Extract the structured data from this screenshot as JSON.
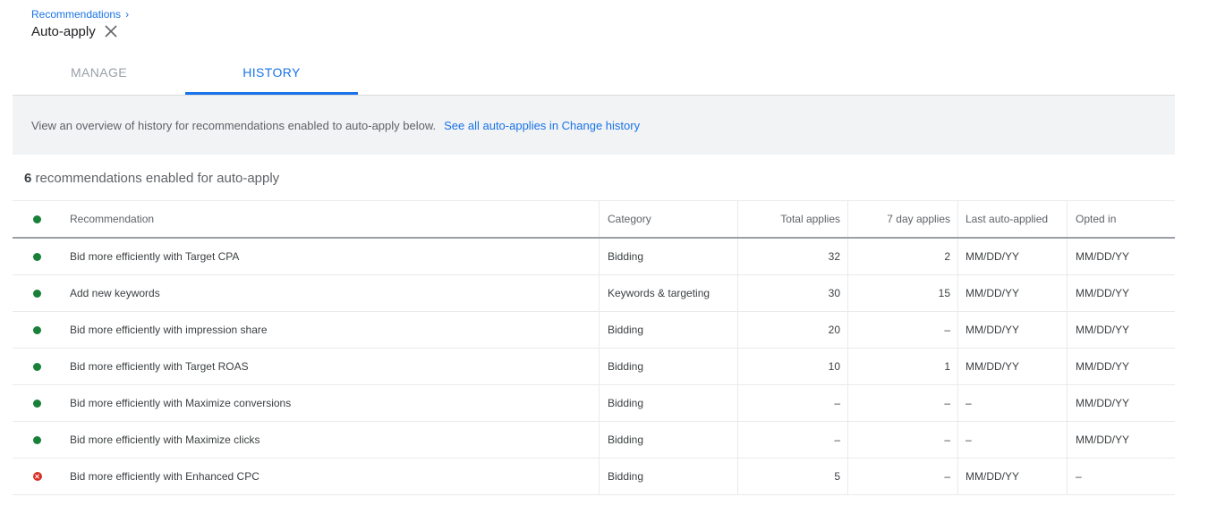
{
  "breadcrumb": {
    "label": "Recommendations",
    "chevron": "›"
  },
  "page": {
    "title": "Auto-apply",
    "close_icon": "close-icon"
  },
  "tabs": [
    {
      "label": "MANAGE",
      "active": false
    },
    {
      "label": "HISTORY",
      "active": true
    }
  ],
  "banner": {
    "text": "View an overview of history for recommendations enabled to auto-apply below.",
    "link": "See all auto-applies in Change history"
  },
  "summary": {
    "count": "6",
    "text": "recommendations enabled for auto-apply"
  },
  "colors": {
    "accent": "#1a73e8",
    "enabled": "#188038",
    "error": "#d93025"
  },
  "table": {
    "headers": {
      "recommendation": "Recommendation",
      "category": "Category",
      "total_applies": "Total applies",
      "seven_day_applies": "7 day applies",
      "last_auto_applied": "Last auto-applied",
      "opted_in": "Opted in"
    },
    "rows": [
      {
        "status": "enabled",
        "recommendation": "Bid more efficiently with Target CPA",
        "category": "Bidding",
        "total_applies": "32",
        "seven_day_applies": "2",
        "last_auto_applied": "MM/DD/YY",
        "opted_in": "MM/DD/YY"
      },
      {
        "status": "enabled",
        "recommendation": "Add new keywords",
        "category": "Keywords & targeting",
        "total_applies": "30",
        "seven_day_applies": "15",
        "last_auto_applied": "MM/DD/YY",
        "opted_in": "MM/DD/YY"
      },
      {
        "status": "enabled",
        "recommendation": "Bid more efficiently with impression share",
        "category": "Bidding",
        "total_applies": "20",
        "seven_day_applies": "–",
        "last_auto_applied": "MM/DD/YY",
        "opted_in": "MM/DD/YY"
      },
      {
        "status": "enabled",
        "recommendation": "Bid more efficiently with Target ROAS",
        "category": "Bidding",
        "total_applies": "10",
        "seven_day_applies": "1",
        "last_auto_applied": "MM/DD/YY",
        "opted_in": "MM/DD/YY"
      },
      {
        "status": "enabled",
        "recommendation": "Bid more efficiently with Maximize conversions",
        "category": "Bidding",
        "total_applies": "–",
        "seven_day_applies": "–",
        "last_auto_applied": "–",
        "opted_in": "MM/DD/YY"
      },
      {
        "status": "enabled",
        "recommendation": "Bid more efficiently with Maximize clicks",
        "category": "Bidding",
        "total_applies": "–",
        "seven_day_applies": "–",
        "last_auto_applied": "–",
        "opted_in": "MM/DD/YY"
      },
      {
        "status": "error",
        "recommendation": "Bid more efficiently with Enhanced CPC",
        "category": "Bidding",
        "total_applies": "5",
        "seven_day_applies": "–",
        "last_auto_applied": "MM/DD/YY",
        "opted_in": "–"
      }
    ]
  }
}
